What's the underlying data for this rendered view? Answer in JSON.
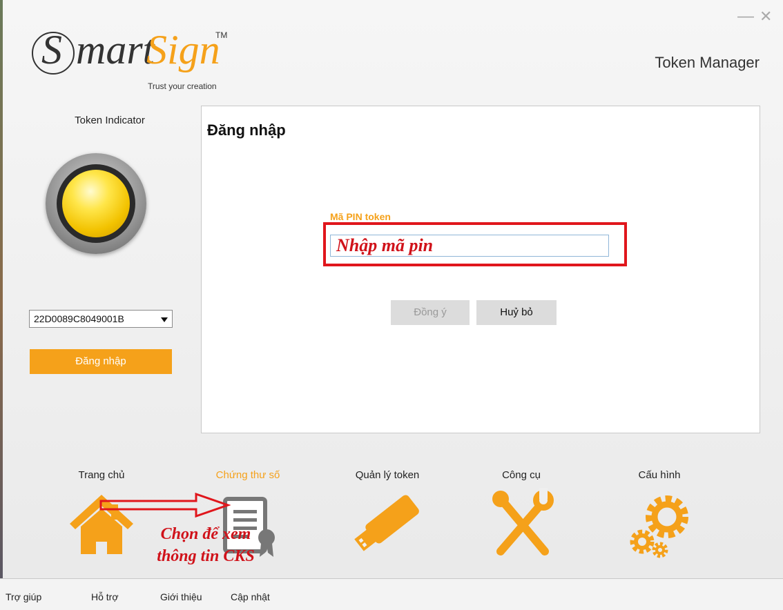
{
  "window": {
    "minimize_glyph": "—",
    "close_glyph": "✕"
  },
  "logo": {
    "s_letter": "S",
    "mart": "mart",
    "sign": "Sign",
    "tm": "TM",
    "tagline": "Trust your creation"
  },
  "app_title": "Token Manager",
  "sidebar": {
    "indicator_label": "Token Indicator",
    "token_select_value": "22D0089C8049001B",
    "login_button": "Đăng nhập"
  },
  "login_panel": {
    "title": "Đăng nhập",
    "pin_label": "Mã PIN token",
    "pin_hint": "Nhập mã pin",
    "ok_button": "Đồng ý",
    "cancel_button": "Huỷ bỏ"
  },
  "nav": [
    {
      "label": "Trang chủ",
      "icon": "home-icon"
    },
    {
      "label": "Chứng thư số",
      "icon": "certificate-icon",
      "active": true
    },
    {
      "label": "Quản lý token",
      "icon": "usb-token-icon"
    },
    {
      "label": "Công cụ",
      "icon": "tools-icon"
    },
    {
      "label": "Cấu hình",
      "icon": "gears-icon"
    }
  ],
  "annotation": {
    "line1": "Chọn để xem",
    "line2": "thông tin CKS"
  },
  "statusbar": [
    "Trợ giúp",
    "Hỗ trợ",
    "Giới thiệu",
    "Cập nhật"
  ],
  "colors": {
    "accent": "#f5a11a",
    "annotation_red": "#d0121a",
    "highlight_box": "#e0161c"
  }
}
